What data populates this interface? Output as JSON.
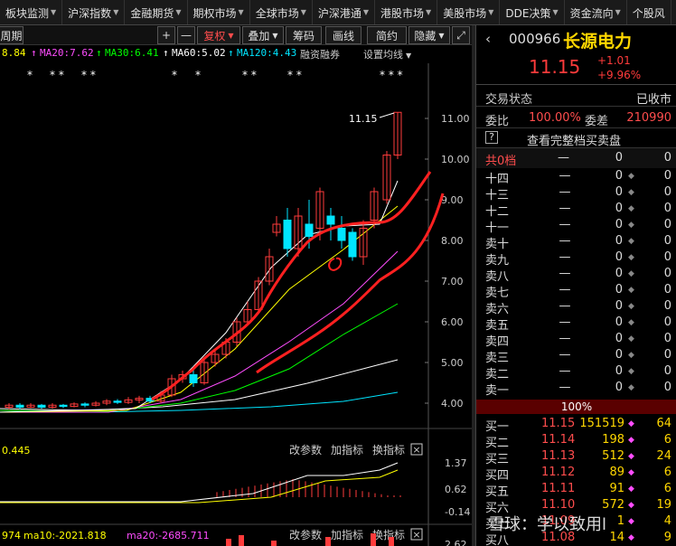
{
  "topnav": [
    {
      "label": "板块监测"
    },
    {
      "label": "沪深指数"
    },
    {
      "label": "金融期货"
    },
    {
      "label": "期权市场"
    },
    {
      "label": "全球市场"
    },
    {
      "label": "沪深港通"
    },
    {
      "label": "港股市场"
    },
    {
      "label": "美股市场"
    },
    {
      "label": "DDE决策"
    },
    {
      "label": "资金流向"
    },
    {
      "label": "个股风"
    }
  ],
  "toolbar": {
    "period": "周期",
    "plus": "+",
    "minus": "—",
    "adjust": "复权",
    "overlay": "叠加",
    "chips": "筹码",
    "draw": "画线",
    "simple": "简约",
    "hide": "隐藏",
    "expand_icon": "expand-icon"
  },
  "ma_row": {
    "ma10": "8.84",
    "ma20": "MA20:7.62",
    "ma30": "MA30:6.41",
    "ma60": "MA60:5.02",
    "ma120": "MA120:4.43",
    "margin": "融资融券",
    "setting": "设置均线"
  },
  "chart_labels": {
    "high_price": "11.15",
    "y_ticks": [
      "11.00",
      "10.00",
      "9.00",
      "8.00",
      "7.00",
      "6.00",
      "5.00",
      "4.00"
    ],
    "macd_value": "0.445",
    "macd_ticks": [
      "1.37",
      "0.62",
      "-0.14"
    ],
    "vol_left": "974",
    "vol_ma10": "ma10:-2021.818",
    "vol_ma20": "ma20:-2685.711",
    "vol_tick": "2.62",
    "edit_params": "改参数",
    "add_indicator": "加指标",
    "switch_indicator": "换指标",
    "close_x": "×"
  },
  "colors": {
    "candle_up": "#ff3b3b",
    "candle_down": "#00e5ff",
    "ma5": "#ffffff",
    "ma10": "#ffff00",
    "ma20": "#ff4dff",
    "ma30": "#00ff00",
    "ma60": "#ffffff",
    "ma120": "#00e5ff"
  },
  "stock": {
    "code": "000966",
    "name": "长源电力",
    "price": "11.15",
    "change": "+1.01",
    "pct": "+9.96%"
  },
  "status": {
    "label": "交易状态",
    "value": "已收市",
    "ratio_label": "委比",
    "ratio_value": "100.00%",
    "diff_label": "委差",
    "diff_value": "210990",
    "help": "?",
    "full_book": "查看完整档买卖盘",
    "total_label": "共0档",
    "total_price": "—",
    "total_vol": "0",
    "total_num": "0"
  },
  "sell_book": [
    {
      "label": "十四",
      "price": "—",
      "vol": "0",
      "num": "0"
    },
    {
      "label": "十三",
      "price": "—",
      "vol": "0",
      "num": "0"
    },
    {
      "label": "十二",
      "price": "—",
      "vol": "0",
      "num": "0"
    },
    {
      "label": "十一",
      "price": "—",
      "vol": "0",
      "num": "0"
    },
    {
      "label": "卖十",
      "price": "—",
      "vol": "0",
      "num": "0"
    },
    {
      "label": "卖九",
      "price": "—",
      "vol": "0",
      "num": "0"
    },
    {
      "label": "卖八",
      "price": "—",
      "vol": "0",
      "num": "0"
    },
    {
      "label": "卖七",
      "price": "—",
      "vol": "0",
      "num": "0"
    },
    {
      "label": "卖六",
      "price": "—",
      "vol": "0",
      "num": "0"
    },
    {
      "label": "卖五",
      "price": "—",
      "vol": "0",
      "num": "0"
    },
    {
      "label": "卖四",
      "price": "—",
      "vol": "0",
      "num": "0"
    },
    {
      "label": "卖三",
      "price": "—",
      "vol": "0",
      "num": "0"
    },
    {
      "label": "卖二",
      "price": "—",
      "vol": "0",
      "num": "0"
    },
    {
      "label": "卖一",
      "price": "—",
      "vol": "0",
      "num": "0"
    }
  ],
  "book_ratio": "100%",
  "buy_book": [
    {
      "label": "买一",
      "price": "11.15",
      "vol": "151519",
      "num": "64"
    },
    {
      "label": "买二",
      "price": "11.14",
      "vol": "198",
      "num": "6"
    },
    {
      "label": "买三",
      "price": "11.13",
      "vol": "512",
      "num": "24"
    },
    {
      "label": "买四",
      "price": "11.12",
      "vol": "89",
      "num": "6"
    },
    {
      "label": "买五",
      "price": "11.11",
      "vol": "91",
      "num": "6"
    },
    {
      "label": "买六",
      "price": "11.10",
      "vol": "572",
      "num": "19"
    },
    {
      "label": "买七",
      "price": "11.09",
      "vol": "1",
      "num": "4"
    },
    {
      "label": "买八",
      "price": "11.08",
      "vol": "14",
      "num": "9"
    }
  ],
  "watermark": "雪球：学以致用l"
}
